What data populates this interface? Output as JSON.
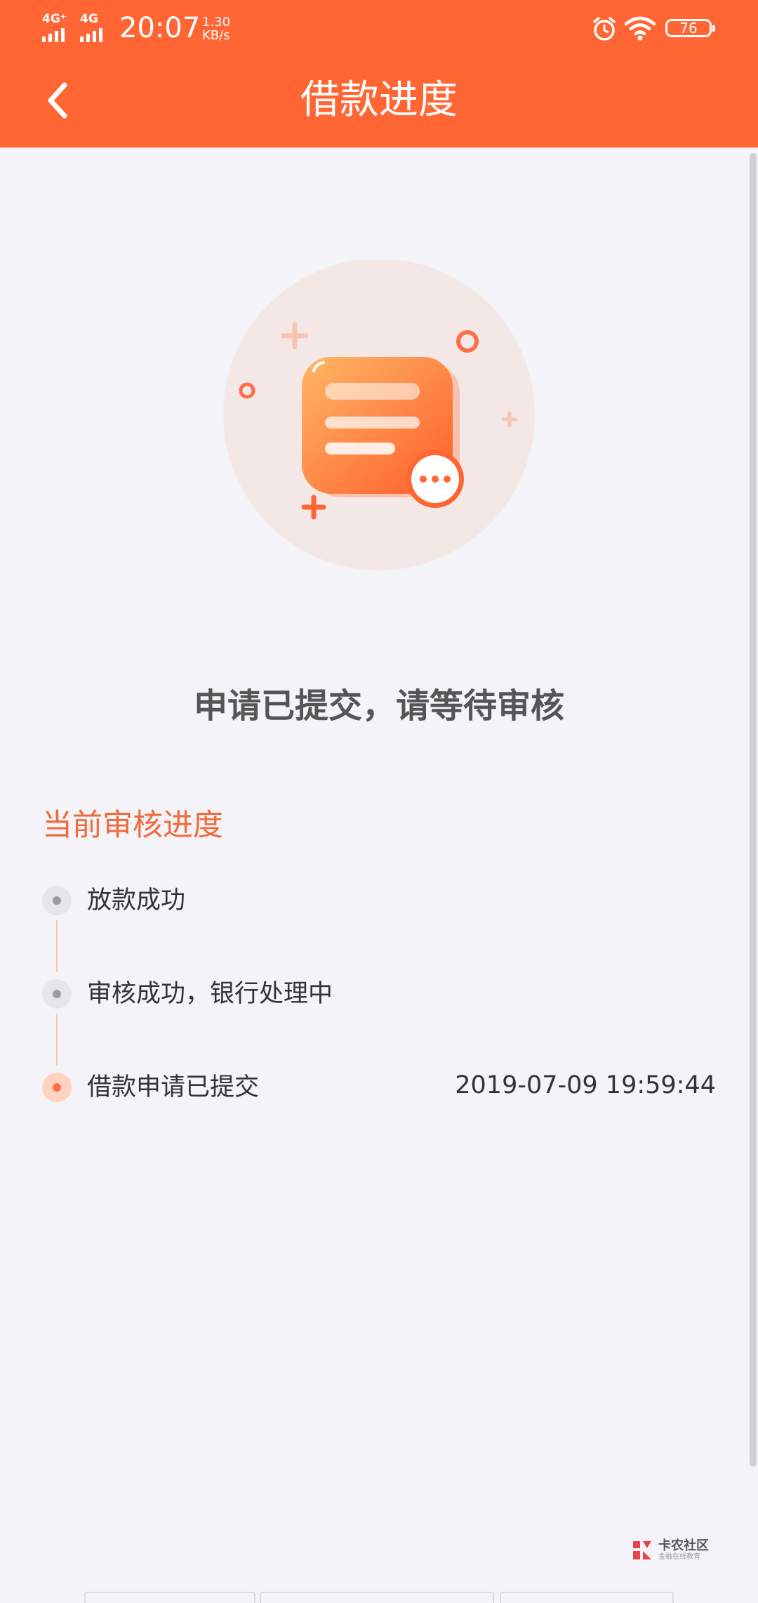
{
  "status_bar": {
    "signal1_label": "4G⁺",
    "signal2_label": "4G",
    "time": "20:07",
    "speed_value": "1.30",
    "speed_unit": "KB/s",
    "battery": "76",
    "icons": [
      "alarm-icon",
      "wifi-icon",
      "battery-icon"
    ]
  },
  "header": {
    "title": "借款进度",
    "back_icon": "chevron-left-icon"
  },
  "main": {
    "illustration": "document-pending-icon",
    "status_message": "申请已提交，请等待审核"
  },
  "progress": {
    "title": "当前审核进度",
    "steps": [
      {
        "label": "放款成功",
        "time": "",
        "active": false
      },
      {
        "label": "审核成功，银行处理中",
        "time": "",
        "active": false
      },
      {
        "label": "借款申请已提交",
        "time": "2019-07-09 19:59:44",
        "active": true
      }
    ]
  },
  "watermark": {
    "main": "卡农社区",
    "sub": "金融在线教育"
  },
  "colors": {
    "accent": "#ff6633",
    "section_title": "#f06a3a",
    "background": "#f4f3f7"
  }
}
